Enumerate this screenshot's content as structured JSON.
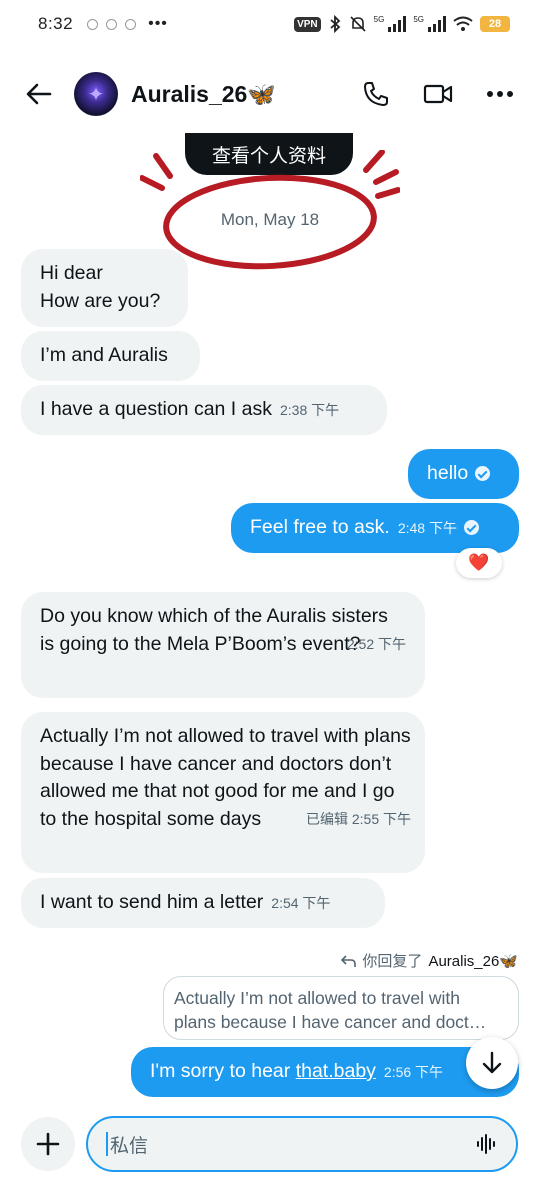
{
  "status_bar": {
    "time": "8:32",
    "more": "•••",
    "vpn": "VPN",
    "sim1": "5G",
    "sim2": "5G",
    "battery": "28"
  },
  "header": {
    "title": "Auralis_26🦋"
  },
  "profile_button": "查看个人资料",
  "date_separator": "Mon, May 18",
  "messages": [
    {
      "text_line1": "Hi dear",
      "text_line2": "How are you?"
    },
    {
      "text": "I’m and Auralis"
    },
    {
      "text": "I have a question can I ask",
      "time": "2:38 下午"
    },
    {
      "text": "hello"
    },
    {
      "text": "Feel free to ask.",
      "time": "2:48 下午",
      "reaction": "❤️"
    },
    {
      "text": "Do you know which of the Auralis sisters is going to the Mela P’Boom’s event?",
      "time": "2:52 下午"
    },
    {
      "text": "Actually I’m not allowed to travel with plans because I have cancer and doctors don’t allowed me that not good for me and I go to the hospital some days",
      "time": "已编辑 2:55 下午"
    },
    {
      "text": "I want to send him a letter",
      "time": "2:54 下午"
    },
    {
      "reply_label": "你回复了",
      "reply_to": "Auralis_26🦋",
      "quoted_line1": "Actually I’m not allowed to travel with",
      "quoted_line2": "plans because I have cancer and doct…",
      "text_before": "I'm sorry to hear ",
      "text_link": "that.baby",
      "time": "2:56 下午"
    }
  ],
  "composer": {
    "placeholder": "私信"
  },
  "colors": {
    "accent": "#1d9bf0",
    "incoming_bubble": "#eff3f4",
    "annotation_red": "#b71c24"
  }
}
